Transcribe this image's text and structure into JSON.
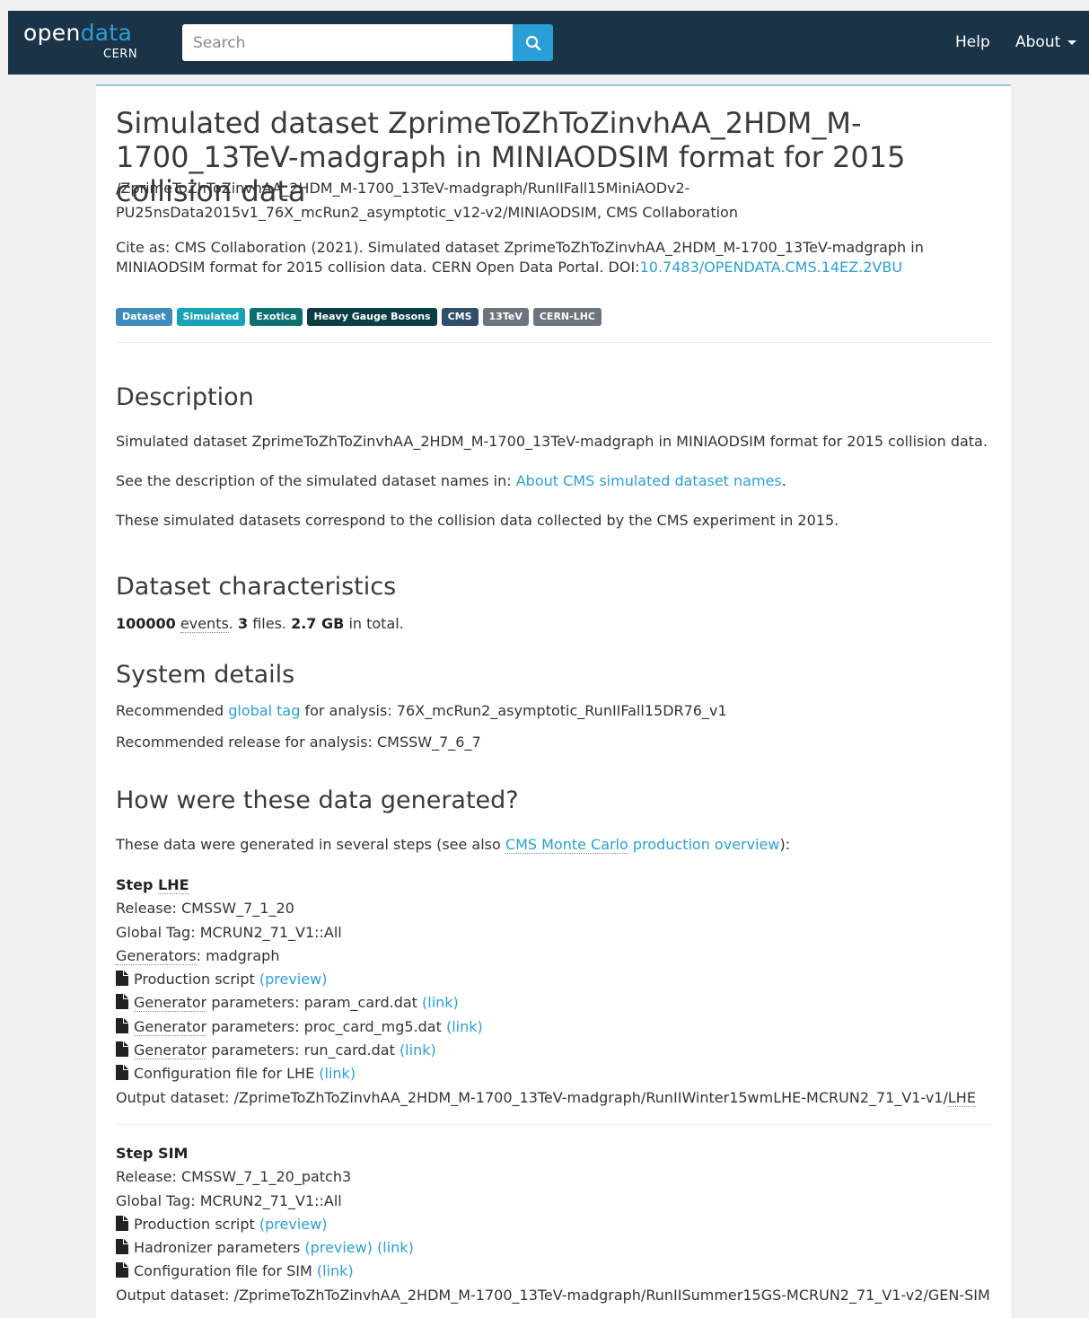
{
  "nav": {
    "logo_open": "open",
    "logo_data": "data",
    "logo_cern": "CERN",
    "search_placeholder": "Search",
    "help": "Help",
    "about": "About"
  },
  "record": {
    "title": "Simulated dataset ZprimeToZhToZinvhAA_2HDM_M-1700_13TeV-madgraph in MINIAODSIM format for 2015 collision data",
    "subtitle_line1": "/ZprimeToZhToZinvhAA_2HDM_M-1700_13TeV-madgraph/RunIIFall15MiniAODv2-",
    "subtitle_line2": "PU25nsData2015v1_76X_mcRun2_asymptotic_v12-v2/MINIAODSIM, CMS Collaboration",
    "cite_text": "Cite as: CMS Collaboration (2021). Simulated dataset ZprimeToZhToZinvhAA_2HDM_M-1700_13TeV-madgraph in MINIAODSIM format for 2015 collision data. CERN Open Data Portal. DOI:",
    "doi": "10.7483/OPENDATA.CMS.14EZ.2VBU"
  },
  "badges": [
    {
      "label": "Dataset",
      "color": "#3c8dbc"
    },
    {
      "label": "Simulated",
      "color": "#17a2b8"
    },
    {
      "label": "Exotica",
      "color": "#0e6f73"
    },
    {
      "label": "Heavy Gauge Bosons",
      "color": "#0b3d44"
    },
    {
      "label": "CMS",
      "color": "#2f4f6b"
    },
    {
      "label": "13TeV",
      "color": "#6c757d"
    },
    {
      "label": "CERN-LHC",
      "color": "#6c757d"
    }
  ],
  "description": {
    "heading": "Description",
    "p1": "Simulated dataset ZprimeToZhToZinvhAA_2HDM_M-1700_13TeV-madgraph in MINIAODSIM format for 2015 collision data.",
    "p2_text": "See the description of the simulated dataset names in: ",
    "p2_link": "About CMS simulated dataset names",
    "p2_end": ".",
    "p3": "These simulated datasets correspond to the collision data collected by the CMS experiment in 2015."
  },
  "characteristics": {
    "heading": "Dataset characteristics",
    "events_count": "100000",
    "events_label": "events",
    "files_count": "3",
    "files_label": "files.",
    "size": "2.7 GB",
    "size_label": "in total."
  },
  "system": {
    "heading": "System details",
    "tag_prefix": "Recommended ",
    "tag_link": "global tag",
    "tag_suffix": " for analysis: 76X_mcRun2_asymptotic_RunIIFall15DR76_v1",
    "release": "Recommended release for analysis: CMSSW_7_6_7"
  },
  "generation": {
    "heading": "How were these data generated?",
    "intro_text": "These data were generated in several steps (see also ",
    "intro_link_a": "CMS Monte Carlo",
    "intro_link_b": " production overview",
    "intro_end": "):"
  },
  "step_lhe": {
    "title_a": "Step ",
    "title_b": "LHE",
    "release": "Release: CMSSW_7_1_20",
    "global_tag": "Global Tag: MCRUN2_71_V1::All",
    "generators_label": "Generators",
    "generators_value": ": madgraph",
    "prod_script": "Production script ",
    "preview": "(preview)",
    "gen_label": "Generator",
    "param1": " parameters: param_card.dat ",
    "param2": " parameters: proc_card_mg5.dat ",
    "param3": " parameters: run_card.dat ",
    "link": "(link)",
    "config": "Configuration file for LHE ",
    "output_a": "Output dataset: /ZprimeToZhToZinvhAA_2HDM_M-1700_13TeV-madgraph/RunIIWinter15wmLHE-MCRUN2_71_V1-v1/",
    "output_b": "LHE"
  },
  "step_sim": {
    "title": "Step SIM",
    "release": "Release: CMSSW_7_1_20_patch3",
    "global_tag": "Global Tag: MCRUN2_71_V1::All",
    "prod_script": "Production script ",
    "preview": "(preview)",
    "hadronizer": "Hadronizer parameters ",
    "link": "(link)",
    "config": "Configuration file for SIM ",
    "output": "Output dataset: /ZprimeToZhToZinvhAA_2HDM_M-1700_13TeV-madgraph/RunIISummer15GS-MCRUN2_71_V1-v2/GEN-SIM"
  }
}
